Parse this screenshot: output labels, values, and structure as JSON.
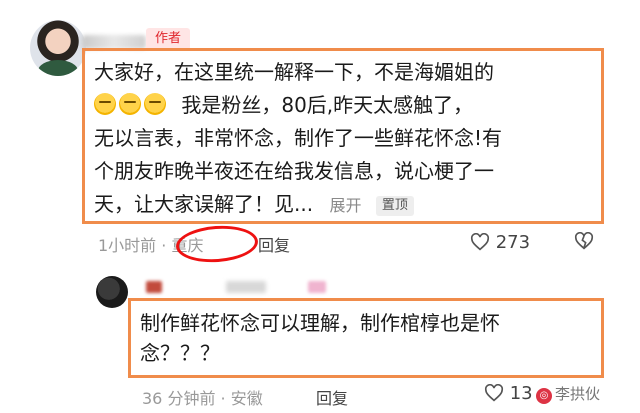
{
  "comment1": {
    "author_tag": "作者",
    "text_line1": "大家好，在这里统一解释一下，不是海媚姐的",
    "text_line2_rest": "我是粉丝，80后,昨天太感触了，",
    "text_line3": "无以言表，非常怀念，制作了一些鲜花怀念!有",
    "text_line4": "个朋友昨晚半夜还在给我发信息，说心梗了一",
    "text_line5": "天，让大家误解了！见...",
    "expand_label": "展开",
    "pin_label": "置顶",
    "time": "1小时前 · ",
    "location": "重庆",
    "reply_label": "回复",
    "like_count": "273"
  },
  "comment2": {
    "text_line1": "制作鲜花怀念可以理解，制作棺椁也是怀",
    "text_line2": "念？？？",
    "time_location": "36 分钟前 · 安徽",
    "reply_label": "回复",
    "like_count": "13"
  },
  "watermark": {
    "text": "李拱伙"
  },
  "colors": {
    "highlight_box": "#f08c4b",
    "circle": "#e11111",
    "author_tag_text": "#e0282e"
  }
}
